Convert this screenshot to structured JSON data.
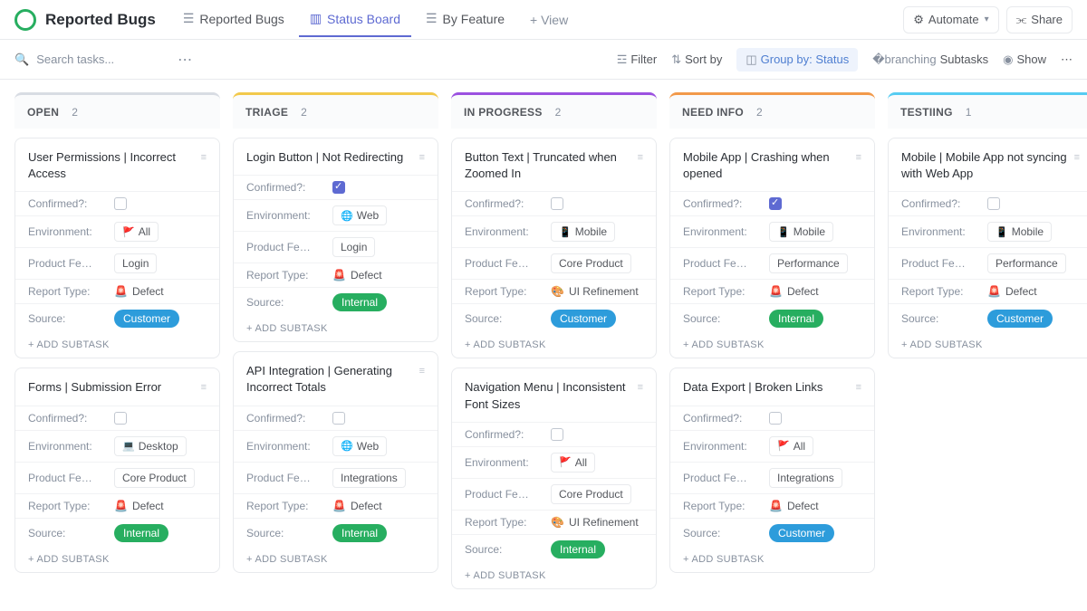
{
  "header": {
    "title": "Reported Bugs",
    "tabs": [
      {
        "label": "Reported Bugs"
      },
      {
        "label": "Status Board"
      },
      {
        "label": "By Feature"
      }
    ],
    "addView": "+  View",
    "automate": "Automate",
    "share": "Share"
  },
  "toolbar": {
    "searchPlaceholder": "Search tasks...",
    "filter": "Filter",
    "sort": "Sort by",
    "groupBy": "Group by:",
    "groupByVal": "Status",
    "subtasks": "Subtasks",
    "show": "Show"
  },
  "fields": {
    "confirmed": "Confirmed?:",
    "environment": "Environment:",
    "productFeature": "Product Fe…",
    "reportType": "Report Type:",
    "source": "Source:"
  },
  "addSubtask": "+ ADD SUBTASK",
  "values": {
    "all": "All",
    "web": "Web",
    "desktop": "Desktop",
    "mobile": "Mobile",
    "login": "Login",
    "coreProduct": "Core Product",
    "integrations": "Integrations",
    "performance": "Performance",
    "defect": "Defect",
    "uiRefinement": "UI Refinement",
    "customer": "Customer",
    "internal": "Internal"
  },
  "columns": [
    {
      "name": "OPEN",
      "count": "2",
      "class": "open"
    },
    {
      "name": "TRIAGE",
      "count": "2",
      "class": "triage"
    },
    {
      "name": "IN PROGRESS",
      "count": "2",
      "class": "inprogress"
    },
    {
      "name": "NEED INFO",
      "count": "2",
      "class": "needinfo"
    },
    {
      "name": "TESTIING",
      "count": "1",
      "class": "testing"
    }
  ],
  "cards": {
    "open": [
      {
        "title": "User Permissions | Incorrect Access",
        "confirmed": false,
        "env": "all",
        "feat": "login",
        "rtype": "defect",
        "source": "customer"
      },
      {
        "title": "Forms | Submission Error",
        "confirmed": false,
        "env": "desktop",
        "feat": "coreProduct",
        "rtype": "defect",
        "source": "internal"
      }
    ],
    "triage": [
      {
        "title": "Login Button | Not Redirecting",
        "confirmed": true,
        "env": "web",
        "feat": "login",
        "rtype": "defect",
        "source": "internal"
      },
      {
        "title": "API Integration | Generating Incorrect Totals",
        "confirmed": false,
        "env": "web",
        "feat": "integrations",
        "rtype": "defect",
        "source": "internal"
      }
    ],
    "inprogress": [
      {
        "title": "Button Text | Truncated when Zoomed In",
        "confirmed": false,
        "env": "mobile",
        "feat": "coreProduct",
        "rtype": "uiRefinement",
        "source": "customer"
      },
      {
        "title": "Navigation Menu | Inconsistent Font Sizes",
        "confirmed": false,
        "env": "all",
        "feat": "coreProduct",
        "rtype": "uiRefinement",
        "source": "internal"
      }
    ],
    "needinfo": [
      {
        "title": "Mobile App | Crashing when opened",
        "confirmed": true,
        "env": "mobile",
        "feat": "performance",
        "rtype": "defect",
        "source": "internal"
      },
      {
        "title": "Data Export | Broken Links",
        "confirmed": false,
        "env": "all",
        "feat": "integrations",
        "rtype": "defect",
        "source": "customer"
      }
    ],
    "testing": [
      {
        "title": "Mobile | Mobile App not syncing with Web App",
        "confirmed": false,
        "env": "mobile",
        "feat": "performance",
        "rtype": "defect",
        "source": "customer"
      }
    ]
  }
}
